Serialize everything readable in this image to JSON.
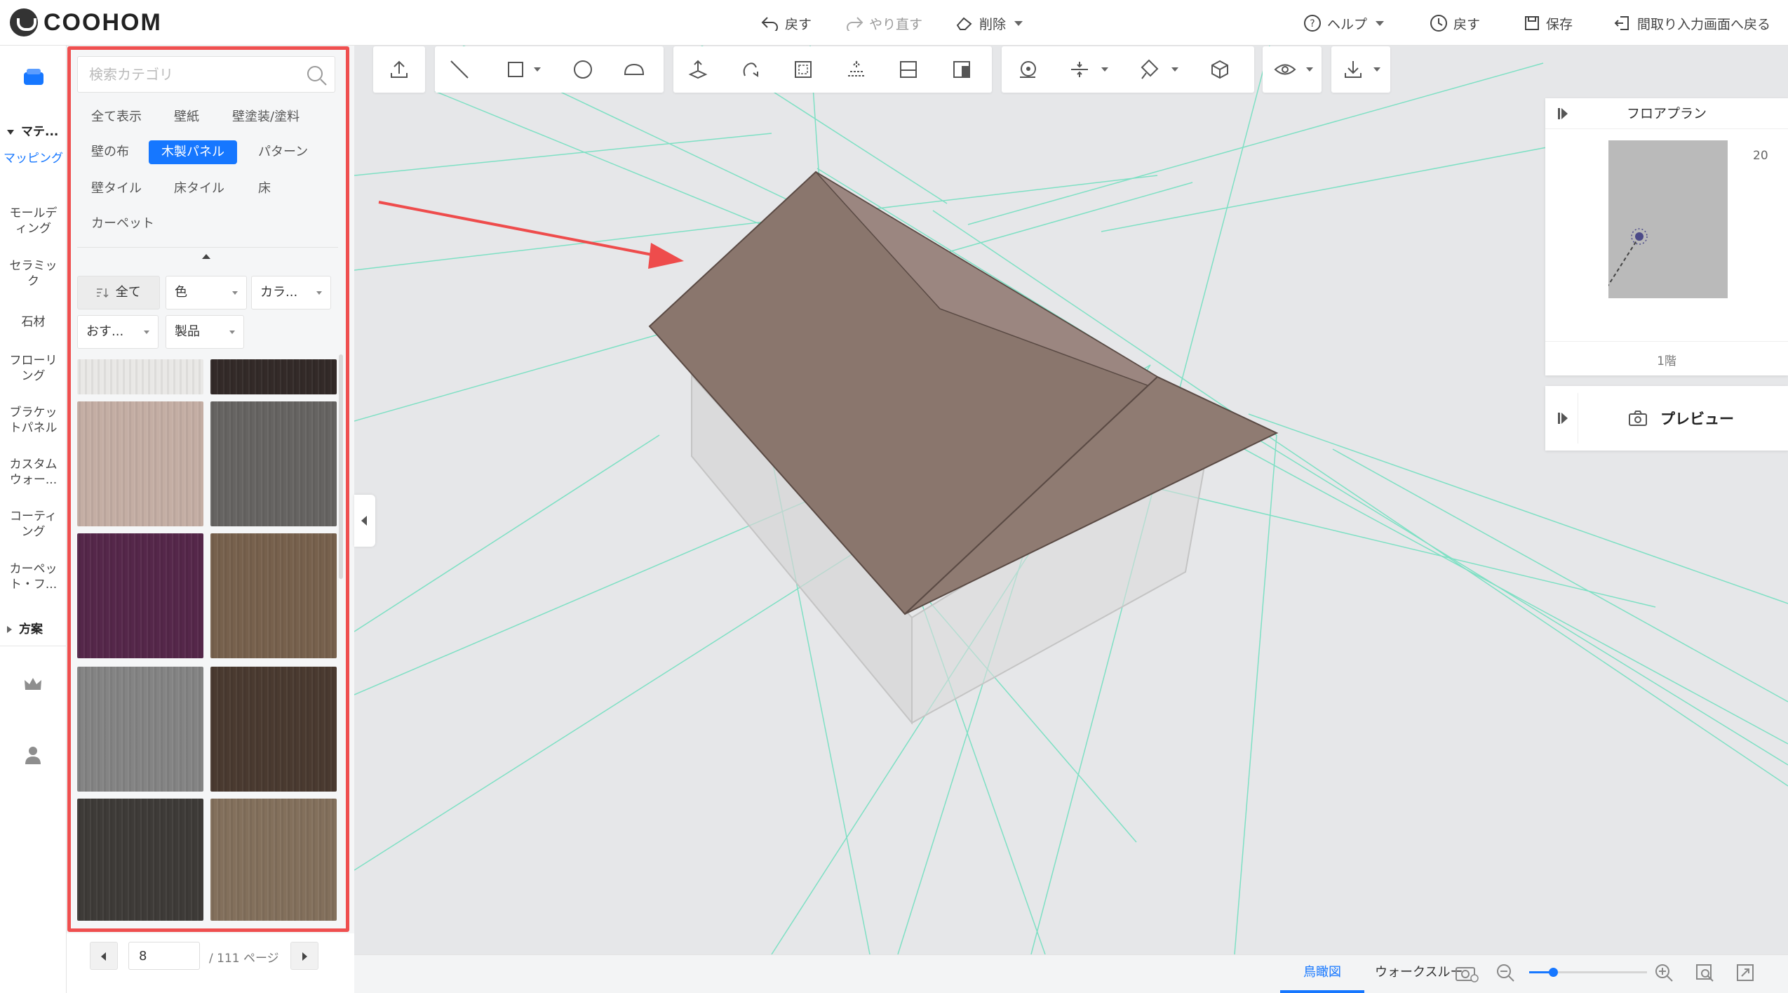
{
  "app": {
    "brand": "COOHOM"
  },
  "topbar": {
    "undo": "戻す",
    "redo": "やり直す",
    "delete": "削除",
    "help": "ヘルプ",
    "history": "戻す",
    "save": "保存",
    "back_to_floorplan": "間取り入力画面へ戻る"
  },
  "rail": {
    "section_materials": "マテ...",
    "items": [
      "マッピング",
      "モールディング",
      "セラミック",
      "石材",
      "フローリング",
      "ブラケットパネル",
      "カスタムウォー...",
      "コーティング",
      "カーペット・フ..."
    ],
    "section_plans": "方案"
  },
  "panel": {
    "search_placeholder": "検索カテゴリ",
    "categories": [
      "全て表示",
      "壁紙",
      "壁塗装/塗料",
      "壁の布",
      "木製パネル",
      "パターン",
      "壁タイル",
      "床タイル",
      "床",
      "カーペット"
    ],
    "active_category": "木製パネル",
    "filters": {
      "all": "全て",
      "color": "色",
      "color_scheme": "カラ...",
      "recommend": "おす...",
      "product": "製品"
    },
    "swatch_colors": [
      "#e9e8e6",
      "#332a28",
      "#c4aea4",
      "#666462",
      "#55274a",
      "#77614d",
      "#848484",
      "#4a3a30",
      "#3e3b38",
      "#83705c"
    ],
    "pager": {
      "current": "8",
      "total": "/ 111 ページ"
    }
  },
  "floorplan": {
    "title": "フロアプラン",
    "scale": "20",
    "floor": "1階"
  },
  "preview": {
    "label": "プレビュー"
  },
  "bottombar": {
    "tab_birdseye": "鳥瞰図",
    "tab_walkthrough": "ウォークスルー",
    "zoom_level": 0.2
  },
  "colors": {
    "accent": "#1677ff",
    "highlight_frame": "#ef4f4f",
    "guide_lines": "#7ee0c4",
    "roof_wood": "#8a766d"
  }
}
